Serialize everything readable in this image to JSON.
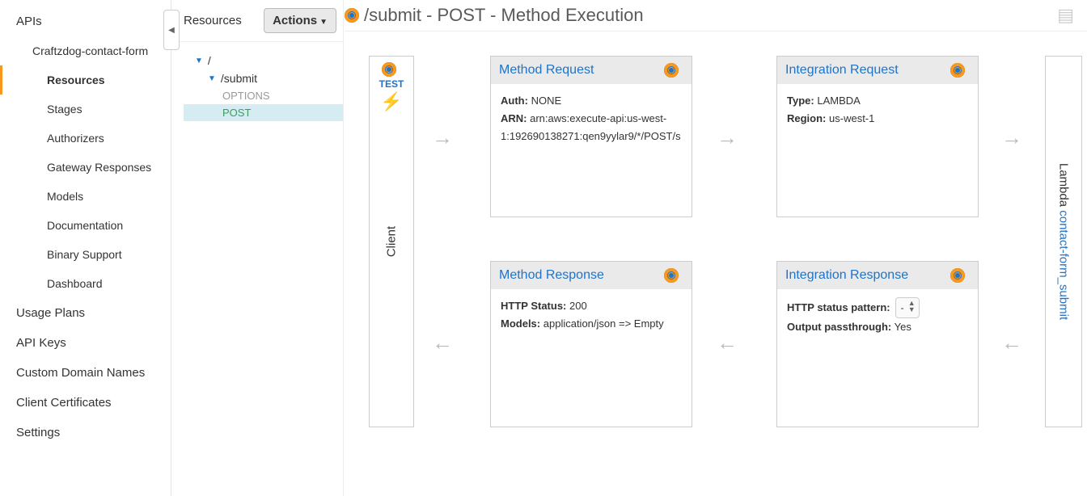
{
  "nav": {
    "apis": "APIs",
    "api_name": "Craftzdog-contact-form",
    "items": [
      "Resources",
      "Stages",
      "Authorizers",
      "Gateway Responses",
      "Models",
      "Documentation",
      "Binary Support",
      "Dashboard"
    ],
    "bottom": [
      "Usage Plans",
      "API Keys",
      "Custom Domain Names",
      "Client Certificates",
      "Settings"
    ]
  },
  "resources": {
    "title": "Resources",
    "actions": "Actions",
    "root": "/",
    "submit": "/submit",
    "options": "OPTIONS",
    "post": "POST"
  },
  "main": {
    "title": "/submit - POST - Method Execution",
    "client": {
      "test": "TEST",
      "label": "Client"
    },
    "lambda": {
      "prefix": "Lambda ",
      "link": "contact-form_submit"
    },
    "method_request": {
      "title": "Method Request",
      "auth_label": "Auth:",
      "auth_value": "NONE",
      "arn_label": "ARN:",
      "arn_value": "arn:aws:execute-api:us-west-1:192690138271:qen9yylar9/*/POST/s"
    },
    "integration_request": {
      "title": "Integration Request",
      "type_label": "Type:",
      "type_value": "LAMBDA",
      "region_label": "Region:",
      "region_value": "us-west-1"
    },
    "method_response": {
      "title": "Method Response",
      "status_label": "HTTP Status:",
      "status_value": "200",
      "models_label": "Models:",
      "models_value": "application/json => Empty"
    },
    "integration_response": {
      "title": "Integration Response",
      "pattern_label": "HTTP status pattern:",
      "pattern_value": "-",
      "passthrough_label": "Output passthrough:",
      "passthrough_value": "Yes"
    }
  }
}
